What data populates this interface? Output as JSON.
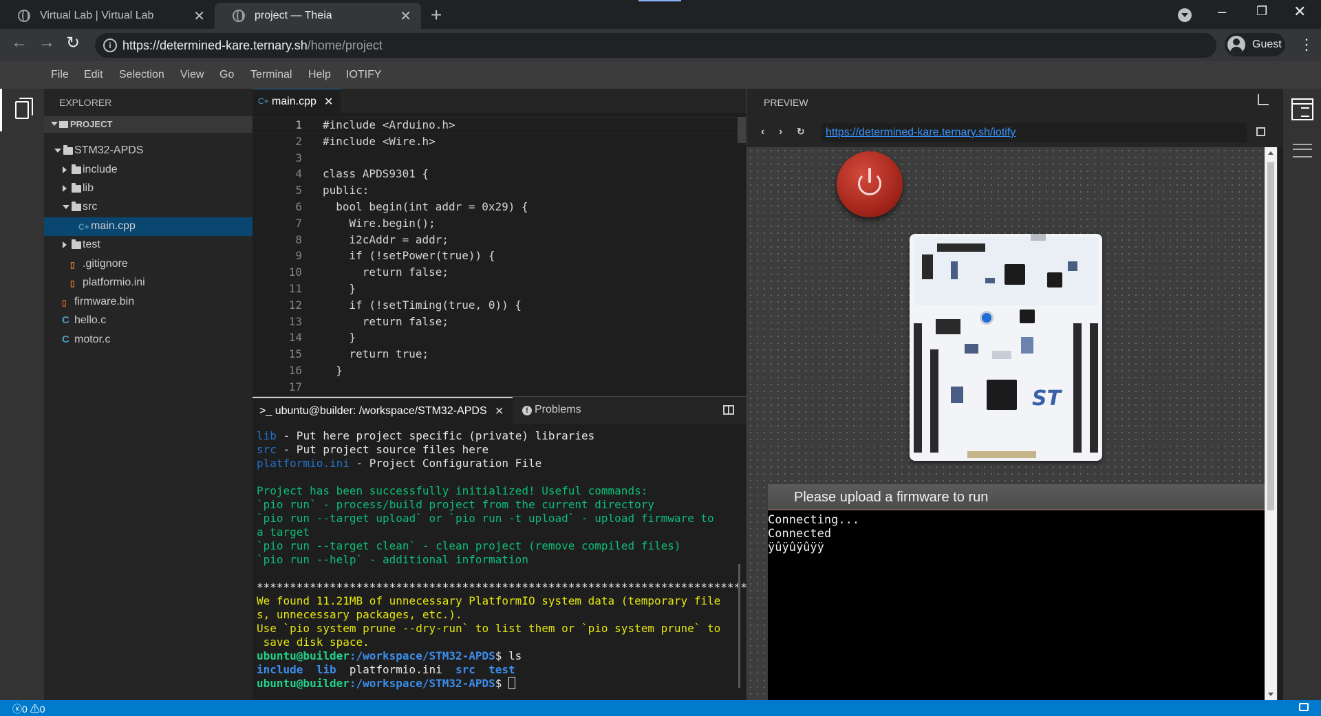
{
  "browser": {
    "tabs": [
      {
        "title": "Virtual Lab | Virtual Lab",
        "active": false
      },
      {
        "title": "project — Theia",
        "active": true
      }
    ],
    "url_host": "https://determined-kare.ternary.sh",
    "url_path": "/home/project",
    "profile": "Guest"
  },
  "menu": [
    "File",
    "Edit",
    "Selection",
    "View",
    "Go",
    "Terminal",
    "Help",
    "IOTIFY"
  ],
  "explorer": {
    "title": "EXPLORER",
    "section": "PROJECT",
    "tree": [
      {
        "label": "STM32-APDS",
        "kind": "folder",
        "open": true,
        "depth": 1
      },
      {
        "label": "include",
        "kind": "folder",
        "open": false,
        "depth": 2
      },
      {
        "label": "lib",
        "kind": "folder",
        "open": false,
        "depth": 2
      },
      {
        "label": "src",
        "kind": "folder",
        "open": true,
        "depth": 2
      },
      {
        "label": "main.cpp",
        "kind": "cpp",
        "depth": 3,
        "selected": true
      },
      {
        "label": "test",
        "kind": "folder",
        "open": false,
        "depth": 2
      },
      {
        "label": ".gitignore",
        "kind": "file",
        "depth": 2
      },
      {
        "label": "platformio.ini",
        "kind": "file",
        "depth": 2
      },
      {
        "label": "firmware.bin",
        "kind": "bin",
        "depth": 1
      },
      {
        "label": "hello.c",
        "kind": "c",
        "depth": 1
      },
      {
        "label": "motor.c",
        "kind": "c",
        "depth": 1
      }
    ]
  },
  "editor": {
    "tab": "main.cpp",
    "lines": [
      "#include <Arduino.h>",
      "#include <Wire.h>",
      "",
      "class APDS9301 {",
      "public:",
      "  bool begin(int addr = 0x29) {",
      "    Wire.begin();",
      "    i2cAddr = addr;",
      "    if (!setPower(true)) {",
      "      return false;",
      "    }",
      "    if (!setTiming(true, 0)) {",
      "      return false;",
      "    }",
      "    return true;",
      "  }",
      ""
    ]
  },
  "terminal": {
    "tab": ">_ ubuntu@builder: /workspace/STM32-APDS",
    "problems_tab": "Problems",
    "lines": [
      [
        {
          "t": "lib",
          "c": "t-blue"
        },
        {
          "t": " - Put here project specific (private) libraries",
          "c": ""
        }
      ],
      [
        {
          "t": "src",
          "c": "t-blue"
        },
        {
          "t": " - Put project source files here",
          "c": ""
        }
      ],
      [
        {
          "t": "platformio.ini",
          "c": "t-blue"
        },
        {
          "t": " - Project Configuration File",
          "c": ""
        }
      ],
      [],
      [
        {
          "t": "Project has been successfully initialized! Useful commands:",
          "c": "t-green"
        }
      ],
      [
        {
          "t": "`pio run` - process/build project from the current directory",
          "c": "t-green"
        }
      ],
      [
        {
          "t": "`pio run --target upload` or `pio run -t upload` - upload firmware to",
          "c": "t-green"
        }
      ],
      [
        {
          "t": "a target",
          "c": "t-green"
        }
      ],
      [
        {
          "t": "`pio run --target clean` - clean project (remove compiled files)",
          "c": "t-green"
        }
      ],
      [
        {
          "t": "`pio run --help` - additional information",
          "c": "t-green"
        }
      ],
      [],
      [
        {
          "t": "***************************************************************************",
          "c": ""
        }
      ],
      [
        {
          "t": "We found 11.21MB of unnecessary PlatformIO system data (temporary file",
          "c": "t-yellow"
        }
      ],
      [
        {
          "t": "s, unnecessary packages, etc.).",
          "c": "t-yellow"
        }
      ],
      [
        {
          "t": "Use `pio system prune --dry-run` to list them or `pio system prune` to",
          "c": "t-yellow"
        }
      ],
      [
        {
          "t": " save disk space.",
          "c": "t-yellow"
        }
      ],
      [
        {
          "t": "ubuntu@builder",
          "c": "t-prompt"
        },
        {
          "t": ":/workspace/STM32-APDS",
          "c": "t-path"
        },
        {
          "t": "$ ls",
          "c": ""
        }
      ],
      [
        {
          "t": "include  lib",
          "c": "t-dirs"
        },
        {
          "t": "  platformio.ini  ",
          "c": ""
        },
        {
          "t": "src  test",
          "c": "t-dirs"
        }
      ],
      [
        {
          "t": "ubuntu@builder",
          "c": "t-prompt"
        },
        {
          "t": ":/workspace/STM32-APDS",
          "c": "t-path"
        },
        {
          "t": "$ ",
          "c": ""
        }
      ]
    ]
  },
  "preview": {
    "title": "PREVIEW",
    "url": "https://determined-kare.ternary.sh/iotify",
    "upload_message": "Please upload a firmware to run",
    "serial": [
      "Connecting...",
      "Connected",
      "ÿûÿûÿûÿÿ"
    ]
  },
  "status": {
    "errors": "0",
    "warnings": "0"
  }
}
